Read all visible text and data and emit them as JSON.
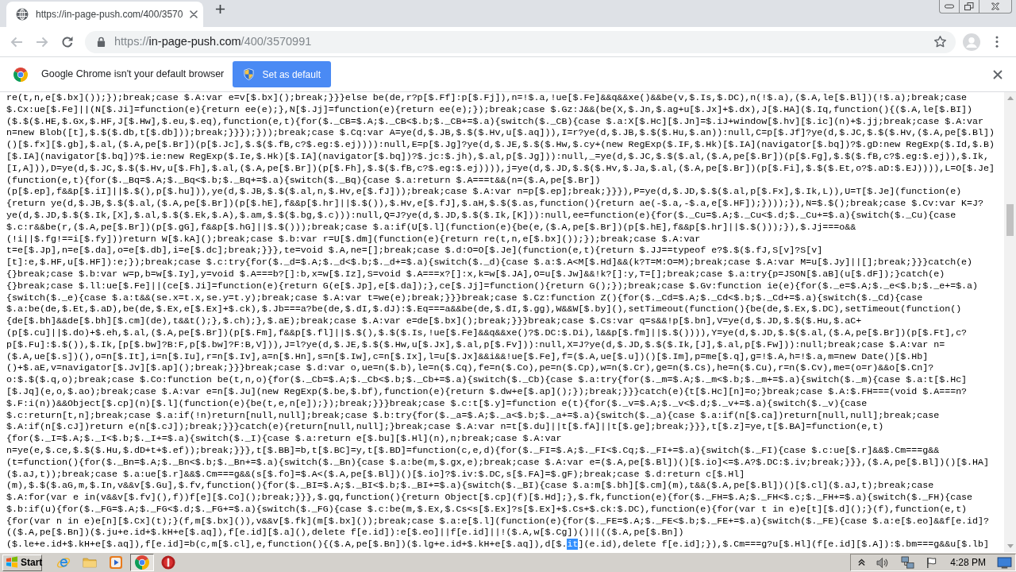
{
  "tabs": [
    {
      "title": "https://in-page-push.com/400/3570",
      "selected": true
    }
  ],
  "navigation": [
    {
      "kind": "back",
      "disabled": true
    },
    {
      "kind": "forward",
      "disabled": true
    },
    {
      "kind": "reload",
      "disabled": false
    }
  ],
  "address_bar": {
    "scheme": "https://",
    "host": "in-page-push.com",
    "path": "/400/3570991"
  },
  "infobar": {
    "message": "Google Chrome isn't your default browser",
    "button": "Set as default"
  },
  "code_lines": [
    "re(t,n,e[$.bx]());});break;case $.A:var e=v[$.bx]();break;}}}else be(de,r?p[$.Ff]:p[$.Fj]),n=!$.a,!ue[$.Fe]&&q&&xe()&&be(v,$.Is,$.DC),n(!$.a),($.A,le[$.Bl])(!$.a);break;case",
    "$.Cx:ue[$.Fe]||(N[$.Ji]=function(e){return ee(e);},N[$.Jj]=function(e){return ee(e);});break;case $.Gz:J&&(be(X,$.Jn,$.ag+u[$.Jx]+$.dx),J[$.HA]($.Iq,function(){($.A,le[$.BI])",
    "($.$($.HE,$.Gx,$.HF,J[$.Hw],$.eu,$.eq),function(e,t){for($._CB=$.A;$._CB<$.b;$._CB+=$.a){switch($._CB){case $.a:X[$.Hc][$.Jn]=$.iJ+window[$.hv][$.ic](n)+$.jj;break;case $.A:var",
    "n=new Blob([t],$.$($.db,t[$.db]));break;}}});}));break;case $.Cq:var A=ye(d,$.JB,$.$($.Hv,u[$.aq])),I=r?ye(d,$.JB,$.$($.Hu,$.an)):null,C=p[$.Jf]?ye(d,$.JC,$.$($.Hv,($.A,pe[$.Bl])",
    "()[$.fx][$.gb],$.al,($.A,pe[$.Br])(p[$.Jc],$.$($.fB,c?$.eg:$.ej)))):null,E=p[$.Jg]?ye(d,$.JE,$.$($.Hw,$.cy+(new RegExp($.IF,$.Hk)[$.IA](navigator[$.bq])?$.gD:new RegExp($.Id,$.B)",
    "[$.IA](navigator[$.bq])?$.ie:new RegExp($.Ie,$.Hk)[$.IA](navigator[$.bq])?$.jc:$.jh),$.al,p[$.Jg])):null,_=ye(d,$.JC,$.$($.al,($.A,pe[$.Br])(p[$.Fg],$.$($.fB,c?$.eg:$.ej)),$.Ik,",
    "[I,A])),D=ye(d,$.JC,$.$($.Hv,u[$.Fh],$.al,($.A,pe[$.Br])(p[$.Fh],$.$($.fB,c?$.eg:$.ej)))),j=ye(d,$.JD,$.$($.Hv,$.Ja,$.al,($.A,pe[$.Br])(p[$.Fi],$.$($.Et,o?$.aD:$.EJ)))),L=O[$.Je]",
    "(function(e,t){for($._Bq=$.A;$._Bq<$.b;$._Bq+=$.a){switch($._Bq){case $.a:return $.A===t&&(n=($.A,pe[$.Br])",
    "(p[$.ep],f&&p[$.iI]||$.$(),p[$.hu])),ye(d,$.JB,$.$($.al,n,$.Hv,e[$.fJ]));break;case $.A:var n=p[$.ep];break;}}}),P=ye(d,$.JD,$.$($.al,p[$.Fx],$.Ik,L)),U=T[$.Je](function(e)",
    "{return ye(d,$.JB,$.$($.al,($.A,pe[$.Br])(p[$.hE],f&&p[$.hr]||$.$()),$.Hv,e[$.fJ],$.aH,$.$($.as,function(){return ae(-$.a,-$.a,e[$.HF]);})));}),N=$.$();break;case $.Cv:var K=J?",
    "ye(d,$.JD,$.$($.Ik,[X],$.al,$.$($.Ek,$.A),$.am,$.$($.bg,$.c))):null,Q=J?ye(d,$.JD,$.$($.Ik,[K])):null,ee=function(e){for($._Cu=$.A;$._Cu<$.d;$._Cu+=$.a){switch($._Cu){case",
    "$.c:r&&be(r,($.A,pe[$.Br])(p[$.gG],f&&p[$.hG]||$.$()));break;case $.a:if(U[$.l](function(e){be(e,($.A,pe[$.Br])(p[$.hE],f&&p[$.hr]||$.$()));}),$.Jj===o&&",
    "(!i||$.fg!==i[$.fy]))return W[$.kA]();break;case $.b:var r=U[$.dm](function(e){return re(t,n,e[$.bx]());});break;case $.A:var",
    "t=e[$.Jp],n=e[$.da],o=e[$.db],i=e[$.dc];break;}}},te=void $.A,ne=[];break;case $.d:O=O[$.Je](function(e,t){return $.JJ==typeof e?$.$($.fJ,S[v]?S[v]",
    "[t]:e,$.HF,u[$.HF]):e;});break;case $.c:try{for($._d=$.A;$._d<$.b;$._d+=$.a){switch($._d){case $.a:$.A<M[$.Hd]&&(k?T=M:O=M);break;case $.A:var M=u[$.Jy]||[];break;}}}catch(e)",
    "{}break;case $.b:var w=p,b=w[$.Iy],y=void $.A===b?[]:b,x=w[$.Iz],S=void $.A===x?[]:x,k=w[$.JA],O=u[$.Jw]&&!k?[]:y,T=[];break;case $.a:try{p=JSON[$.aB](u[$.dF]);}catch(e)",
    "{}break;case $.ll:ue[$.Fe]||(ce[$.Ji]=function(e){return G(e[$.Jp],e[$.da]);},ce[$.Jj]=function(){return G();});break;case $.Gv:function ie(e){for($._e=$.A;$._e<$.b;$._e+=$.a)",
    "{switch($._e){case $.a:t&&(se.x=t.x,se.y=t.y);break;case $.A:var t=we(e);break;}}}break;case $.Cz:function Z(){for($._Cd=$.A;$._Cd<$.b;$._Cd+=$.a){switch($._Cd){case",
    "$.a:be(de,$.Et,$.aD),be(de,$.Ex,e[$.Ex]+$.ck),$.Jb===a?be(de,$.dI,$.dJ):$.Eq===a&&be(de,$.dI,$.gg),W&&W[$.by](),setTimeout(function(){be(de,$.Ex,$.DC),setTimeout(function()",
    "{de[$.bh]&&de[$.bh][$.cm](de),t&&t();},$.ch);},$.aE);break;case $.A:var e=de[$.bx]();break;}}}break;case $.Cs:var q=s&&!p[$.bn],V=ye(d,$.JD,$.$($.Hu,$.aC+",
    "(p[$.cu]||$.do)+$.eh,$.al,($.A,pe[$.Br])(p[$.Fm],f&&p[$.fl]||$.$(),$.$($.Is,!ue[$.Fe]&&q&&xe()?$.DC:$.Di),l&&p[$.fm]||$.$()))),Y=ye(d,$.JD,$.$($.al,($.A,pe[$.Br])(p[$.Ft],c?",
    "p[$.Fu]:$.$()),$.Ik,[p[$.bw]?B:F,p[$.bw]?F:B,V])),J=l?ye(d,$.JE,$.$($.Hw,u[$.Jx],$.al,p[$.Fv])):null,X=J?ye(d,$.JD,$.$($.Ik,[J],$.al,p[$.Fw])):null;break;case $.A:var n=",
    "($.A,ue[$.s])(),o=n[$.It],i=n[$.Iu],r=n[$.Iv],a=n[$.Hn],s=n[$.Iw],c=n[$.Ix],l=u[$.Jx]&&i&&!ue[$.Fe],f=($.A,ue[$.u])()[$.Im],p=me[$.q],g=!$.A,h=!$.a,m=new Date()[$.Hb]",
    "()+$.aE,v=navigator[$.Jv][$.ap]();break;}}}break;case $.d:var o,ue=n($.b),le=n($.Cq),fe=n($.Co),pe=n($.Cp),w=n($.Cr),ge=n($.Cs),he=n($.Cu),r=n($.Cv),me=(o=r)&&o[$.Cn]?",
    "o:$.$($.q,o);break;case $.Co:function be(t,n,o){for($._Cb=$.A;$._Cb<$.b;$._Cb+=$.a){switch($._Cb){case $.a:try{for($._m=$.A;$._m<$.b;$._m+=$.a){switch($._m){case $.a:t[$.Hc]",
    "[$.Jq](e,o,$.ao);break;case $.A:var e=n[$.Ju](new RegExp($.be,$.bf),function(e){return $.dw+e[$.ap]();});break;}}}catch(e){t[$.Hc][n]=o;}break;case $.A:$.FH===(void $.A===n?",
    "$.F:i(n))&&Object[$.cp](n)[$.l](function(e){be(t,e,n[e]);});break;}}}break;case $.c:t[$.y]=function e(t){for($._v=$.A;$._v<$.d;$._v+=$.a){switch($._v){case",
    "$.c:return[t,n];break;case $.a:if(!n)return[null,null];break;case $.b:try{for($._a=$.A;$._a<$.b;$._a+=$.a){switch($._a){case $.a:if(n[$.ca])return[null,null];break;case",
    "$.A:if(n[$.cJ])return e(n[$.cJ]);break;}}}catch(e){return[null,null];}break;case $.A:var n=t[$.du]||t[$.fA]||t[$.ge];break;}}},t[$.z]=ye,t[$.BA]=function(e,t)",
    "{for($._I=$.A;$._I<$.b;$._I+=$.a){switch($._I){case $.a:return e[$.bu][$.Hl](n),n;break;case $.A:var",
    "n=ye(e,$.ce,$.$($.Hu,$.dD+t+$.ef));break;}}},t[$.BB]=b,t[$.BC]=y,t[$.BD]=function(c,e,d){for($._FI=$.A;$._FI<$.Cq;$._FI+=$.a){switch($._FI){case $.c:ue[$.r]&&$.Cm===g&&",
    "(t=function(){for($._Bn=$.A;$._Bn<$.b;$._Bn+=$.a){switch($._Bn){case $.a:be(m,$.gx,e);break;case $.A:var e=($.A,pe[$.Bl])()[$.io]<=$.A?$.DC:$.iv;break;}}},($.A,pe[$.Bl])()[$.HA]",
    "($.aJ,t));break;case $.a:ue[$.r]&&$.Cm===g&&(s[$.fo]=$.A<($.A,pe[$.Bl])()[$.io]?$.iv:$.DC,s[$.FA]=$.gF);break;case $.d:return c[$.Hl]",
    "(m),$.$($.aG,m,$.In,v&&v[$.Gu],$.fv,function(){for($._BI=$.A;$._BI<$.b;$._BI+=$.a){switch($._BI){case $.a:m[$.bh][$.cm](m),t&&($.A,pe[$.Bl])()[$.cl]($.aJ,t);break;case",
    "$.A:for(var e in(v&&v[$.fv](),f))f[e][$.Co]();break;}}},$.gq,function(){return Object[$.cp](f)[$.Hd];},$.fk,function(e){for($._FH=$.A;$._FH<$.c;$._FH+=$.a){switch($._FH){case",
    "$.b:if(u){for($._FG=$.A;$._FG<$.d;$._FG+=$.a){switch($._FG){case $.c:be(m,$.Ex,$.Cs<s[$.Ex]?s[$.Ex]+$.Cs+$.ck:$.DC),function(e){for(var t in e)e[t][$.d]();}(f),function(e,t)",
    "{for(var n in e)e[n][$.Cx](t);}(f,m[$.bx]()),v&&v[$.fk](m[$.bx]());break;case $.a:e[$.l](function(e){for($._FE=$.A;$._FE<$.b;$._FE+=$.a){switch($._FE){case $.a:e[$.eo]&&f[e.id]?",
    "(($.A,pe[$.Bn])($.ju+e.id+$.kH+e[$.aq]),f[e.id][$.a](),delete f[e.id]):e[$.eo]||f[e.id]||!($.A,w[$.Cg])()||(($.A,pe[$.Bn])",
    [
      {
        "text": "($.le+e.id+$.kH+e[$.aq]),f[e.id]=b(c,m[$.cl],e,function(){($.A,pe[$.Bn])($.lg+e.id+$.kH+e[$.aq]),d[$.",
        "selected": false
      },
      {
        "text": "it",
        "selected": true
      },
      {
        "text": "](e.id),delete f[e.id];}),$.Cm===g?u[$.Hl](f[e.id][$.A]):$.bm===g&&u[$.lb]",
        "selected": false
      }
    ]
  ],
  "taskbar": {
    "start": "Start",
    "apps": [
      {
        "kind": "ie",
        "selected": false
      },
      {
        "kind": "folder",
        "selected": false
      },
      {
        "kind": "media",
        "selected": false
      },
      {
        "kind": "chrome",
        "selected": true
      },
      {
        "kind": "round",
        "selected": false
      }
    ],
    "clock": "4:28 PM"
  }
}
